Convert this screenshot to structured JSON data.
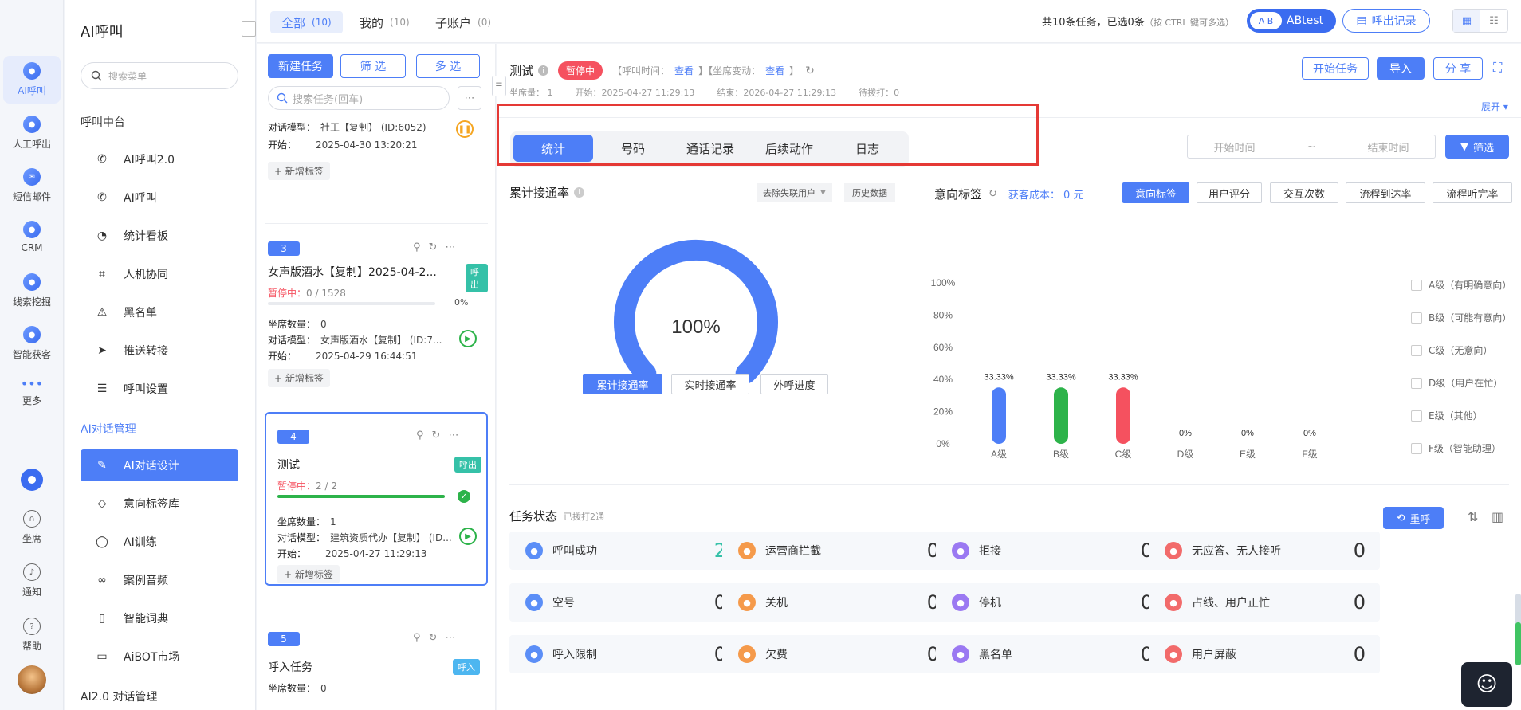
{
  "rail": {
    "items": [
      {
        "label": "AI呼叫",
        "icon": "ai-call-icon"
      },
      {
        "label": "人工呼出",
        "icon": "manual-call-icon"
      },
      {
        "label": "短信邮件",
        "icon": "sms-mail-icon"
      },
      {
        "label": "CRM",
        "icon": "crm-icon"
      },
      {
        "label": "线索挖掘",
        "icon": "lead-mining-icon"
      },
      {
        "label": "智能获客",
        "icon": "smart-acquire-icon"
      },
      {
        "label": "更多",
        "icon": "more-icon"
      }
    ],
    "bottom": [
      {
        "label": "坐席",
        "icon": "headset-icon"
      },
      {
        "label": "通知",
        "icon": "bell-icon"
      },
      {
        "label": "帮助",
        "icon": "help-icon"
      }
    ]
  },
  "menu": {
    "title": "AI呼叫",
    "search_placeholder": "搜索菜单",
    "section1": "呼叫中台",
    "items1": [
      "AI呼叫2.0",
      "AI呼叫",
      "统计看板",
      "人机协同",
      "黑名单",
      "推送转接",
      "呼叫设置"
    ],
    "section2": "AI对话管理",
    "items2": [
      "AI对话设计",
      "意向标签库",
      "AI训练",
      "案例音频",
      "智能词典",
      "AiBOT市场"
    ],
    "section3": "AI2.0 对话管理"
  },
  "topbar": {
    "tabs": [
      {
        "label": "全部",
        "count": "(10)"
      },
      {
        "label": "我的",
        "count": "(10)"
      },
      {
        "label": "子账户",
        "count": "(0)"
      }
    ],
    "summary": "共10条任务，已选0条",
    "summary_hint": "（按 CTRL 键可多选）",
    "user": "ABtest",
    "avatar_text": "A B",
    "call_records": "呼出记录"
  },
  "tasklist": {
    "new_task": "新建任务",
    "filter": "筛 选",
    "multi": "多 选",
    "search_placeholder": "搜索任务(回车)",
    "add_tag": "+ 新增标签",
    "card0": {
      "model_label": "对话模型：",
      "model_value": "社王【复制】 (ID:6052)",
      "start_label": "开始：",
      "start": "2025-04-30 13:20:21"
    },
    "card1": {
      "num": "3",
      "title": "女声版酒水【复制】2025-04-2...",
      "tag": "呼出",
      "status": "暂停中：",
      "progress": "0 / 1528",
      "percent": "0%",
      "seats_label": "坐席数量：",
      "seats": "0",
      "model_label": "对话模型：",
      "model": "女声版酒水【复制】 (ID:7...",
      "start_label": "开始：",
      "start": "2025-04-29 16:44:51"
    },
    "card2": {
      "num": "4",
      "title": "测试",
      "tag": "呼出",
      "status": "暂停中：",
      "progress": "2 / 2",
      "seats_label": "坐席数量：",
      "seats": "1",
      "model_label": "对话模型：",
      "model": "建筑资质代办【复制】 (ID...",
      "start_label": "开始：",
      "start": "2025-04-27 11:29:13"
    },
    "card3": {
      "num": "5",
      "title": "呼入任务",
      "tag": "呼入",
      "seats_label": "坐席数量：",
      "seats": "0"
    }
  },
  "detail": {
    "title": "测试",
    "status": "暂停中",
    "call_time_label": "【呼叫时间：",
    "call_time_link": "查看",
    "seat_change_label": "】【坐席变动：",
    "seat_change_link": "查看",
    "close_bracket": "】",
    "seats": "坐席量：  1",
    "start": "开始：2025-04-27 11:29:13",
    "end": "结束：2026-04-27 11:29:13",
    "pending": "待拨打：0",
    "btn_start": "开始任务",
    "btn_import": "导入",
    "btn_share": "分 享",
    "expand": "展开",
    "tabs": [
      "统计",
      "号码",
      "通话记录",
      "后续动作",
      "日志"
    ],
    "start_time_ph": "开始时间",
    "tilde": "~",
    "end_time_ph": "结束时间",
    "filter": "筛选"
  },
  "rate": {
    "title": "累计接通率",
    "dropdown": "去除失联用户",
    "history": "历史数据",
    "gauge_text": "100%",
    "gauge_value": 1.0,
    "buttons": [
      "累计接通率",
      "实时接通率",
      "外呼进度"
    ]
  },
  "intent": {
    "title": "意向标签",
    "cost": "获客成本：  0 元",
    "buttons": [
      "意向标签",
      "用户评分",
      "交互次数",
      "流程到达率",
      "流程听完率"
    ],
    "legend": [
      "A级（有明确意向）",
      "B级（可能有意向）",
      "C级（无意向）",
      "D级（用户在忙）",
      "E级（其他）",
      "F级（智能助理）"
    ]
  },
  "chart_data": {
    "type": "bar",
    "categories": [
      "A级",
      "B级",
      "C级",
      "D级",
      "E级",
      "F级"
    ],
    "values": [
      33.33,
      33.33,
      33.33,
      0,
      0,
      0
    ],
    "labels": [
      "33.33%",
      "33.33%",
      "33.33%",
      "0%",
      "0%",
      "0%"
    ],
    "colors": [
      "#4d7ef7",
      "#2db34a",
      "#f5515f",
      "#cccccc",
      "#cccccc",
      "#cccccc"
    ],
    "yticks": [
      "100%",
      "80%",
      "60%",
      "40%",
      "20%",
      "0%"
    ],
    "ylim": [
      0,
      100
    ]
  },
  "task_status": {
    "title": "任务状态",
    "sub": "已拨打2通",
    "redial": "重呼",
    "items": [
      {
        "name": "呼叫成功",
        "value": "2",
        "color": "#5b8ef7",
        "icon": "phone-icon",
        "highlight": true
      },
      {
        "name": "运营商拦截",
        "value": "0",
        "color": "#f59a4b",
        "icon": "block-icon"
      },
      {
        "name": "拒接",
        "value": "0",
        "color": "#9b79f2",
        "icon": "reject-icon"
      },
      {
        "name": "无应答、无人接听",
        "value": "0",
        "color": "#f26b6b",
        "icon": "no-answer-icon"
      },
      {
        "name": "空号",
        "value": "0",
        "color": "#5b8ef7",
        "icon": "empty-number-icon"
      },
      {
        "name": "关机",
        "value": "0",
        "color": "#f59a4b",
        "icon": "power-icon"
      },
      {
        "name": "停机",
        "value": "0",
        "color": "#9b79f2",
        "icon": "stop-icon"
      },
      {
        "name": "占线、用户正忙",
        "value": "0",
        "color": "#f26b6b",
        "icon": "busy-icon"
      },
      {
        "name": "呼入限制",
        "value": "0",
        "color": "#5b8ef7",
        "icon": "limit-icon"
      },
      {
        "name": "欠费",
        "value": "0",
        "color": "#f59a4b",
        "icon": "arrears-icon"
      },
      {
        "name": "黑名单",
        "value": "0",
        "color": "#9b79f2",
        "icon": "blacklist-icon"
      },
      {
        "name": "用户屏蔽",
        "value": "0",
        "color": "#f26b6b",
        "icon": "user-block-icon"
      }
    ]
  }
}
